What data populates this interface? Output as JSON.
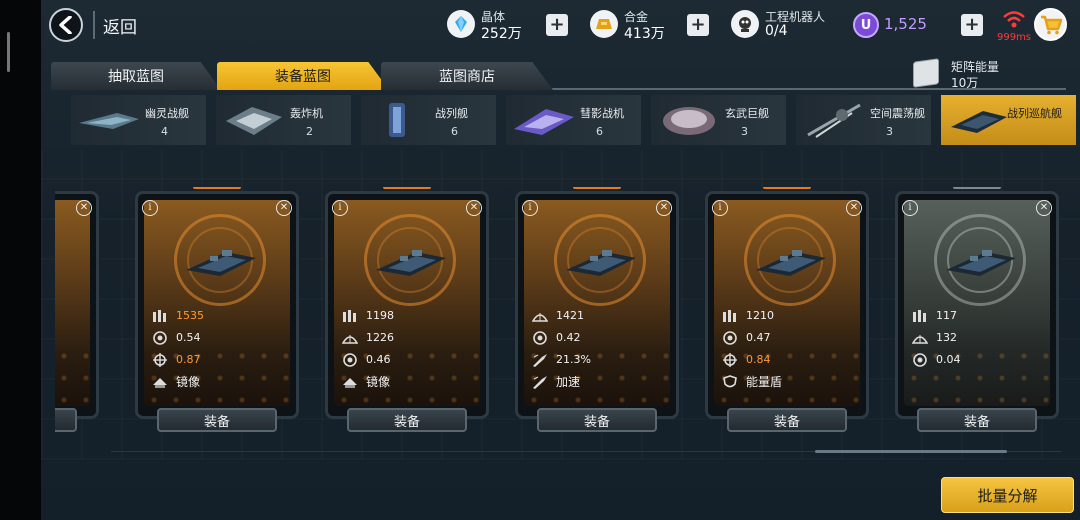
{
  "header": {
    "back_label": "返回",
    "crystal": {
      "label": "晶体",
      "value": "252万"
    },
    "alloy": {
      "label": "合金",
      "value": "413万"
    },
    "robot": {
      "label": "工程机器人",
      "value": "0/4"
    },
    "u_currency": {
      "symbol": "U",
      "value": "1,525"
    },
    "ping": "999ms"
  },
  "tabs": [
    {
      "label": "抽取蓝图",
      "active": false
    },
    {
      "label": "装备蓝图",
      "active": true
    },
    {
      "label": "蓝图商店",
      "active": false
    }
  ],
  "matrix_energy": {
    "label": "矩阵能量",
    "value": "10万"
  },
  "categories": [
    {
      "name": "幽灵战舰",
      "count": "4"
    },
    {
      "name": "轰炸机",
      "count": "2"
    },
    {
      "name": "战列舰",
      "count": "6"
    },
    {
      "name": "彗影战机",
      "count": "6"
    },
    {
      "name": "玄武巨舰",
      "count": "3"
    },
    {
      "name": "空间震荡舰",
      "count": "3"
    },
    {
      "name": "战列巡航舰",
      "count": "",
      "active": true
    }
  ],
  "cards": [
    {
      "stats": [
        {
          "icon": "ammo-icon",
          "value": "1535",
          "highlight": true
        },
        {
          "icon": "speed-icon",
          "value": "0.54",
          "highlight": false
        },
        {
          "icon": "crosshair-icon",
          "value": "0.87",
          "highlight": true
        },
        {
          "icon": "mirror-icon",
          "value": "镜像",
          "highlight": false
        }
      ],
      "equip": "装备",
      "theme": "orange"
    },
    {
      "stats": [
        {
          "icon": "ammo-icon",
          "value": "1198",
          "highlight": false
        },
        {
          "icon": "armor-icon",
          "value": "1226",
          "highlight": false
        },
        {
          "icon": "speed-icon",
          "value": "0.46",
          "highlight": false
        },
        {
          "icon": "mirror-icon",
          "value": "镜像",
          "highlight": false
        }
      ],
      "equip": "装备",
      "theme": "orange"
    },
    {
      "stats": [
        {
          "icon": "armor-icon",
          "value": "1421",
          "highlight": false
        },
        {
          "icon": "speed-icon",
          "value": "0.42",
          "highlight": false
        },
        {
          "icon": "boost-icon",
          "value": "21.3%",
          "highlight": false
        },
        {
          "icon": "boost-icon",
          "value": "加速",
          "highlight": false
        }
      ],
      "equip": "装备",
      "theme": "orange"
    },
    {
      "stats": [
        {
          "icon": "ammo-icon",
          "value": "1210",
          "highlight": false
        },
        {
          "icon": "speed-icon",
          "value": "0.47",
          "highlight": false
        },
        {
          "icon": "crosshair-icon",
          "value": "0.84",
          "highlight": true
        },
        {
          "icon": "shield-icon",
          "value": "能量盾",
          "highlight": false
        }
      ],
      "equip": "装备",
      "theme": "orange"
    },
    {
      "stats": [
        {
          "icon": "ammo-icon",
          "value": "117",
          "highlight": false
        },
        {
          "icon": "armor-icon",
          "value": "132",
          "highlight": false
        },
        {
          "icon": "speed-icon",
          "value": "0.04",
          "highlight": false
        }
      ],
      "equip": "装备",
      "theme": "gray"
    }
  ],
  "bulk_button": "批量分解",
  "colors": {
    "accent": "#f0b52a",
    "highlight_value": "#ff9a33",
    "ping_red": "#ff3a3a",
    "u_purple": "#c29bff"
  }
}
